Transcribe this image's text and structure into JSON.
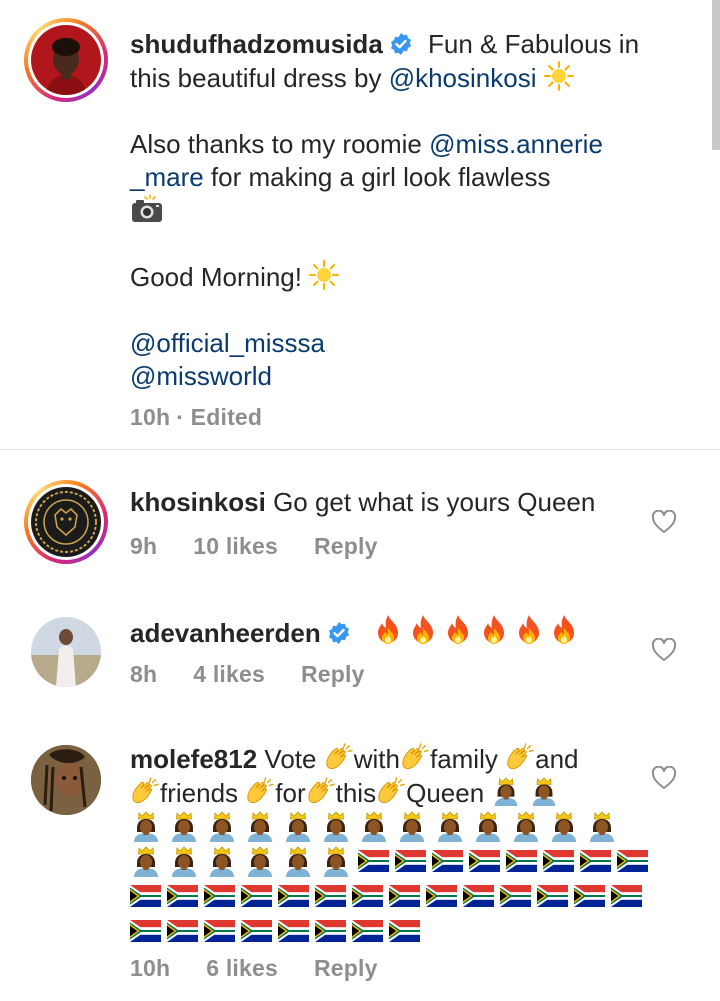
{
  "caption": {
    "username": "shudufhadzomusida",
    "line1_text": "Fun & Fabulous in",
    "line2_prefix": "this beautiful dress by ",
    "line2_mention": "@khosinkosi",
    "line3_prefix": "Also thanks to my roomie ",
    "line3_mention": "@miss.annerie",
    "line4_mention": "_mare",
    "line4_text": " for making a girl look flawless",
    "greeting": "Good Morning!",
    "mention_a": "@official_misssa",
    "mention_b": "@missworld",
    "time": "10h",
    "edited": "· Edited"
  },
  "comments": [
    {
      "username": "khosinkosi",
      "text": "Go get what is yours Queen",
      "time": "9h",
      "likes": "10 likes",
      "reply": "Reply"
    },
    {
      "username": "adevanheerden",
      "text": "",
      "time": "8h",
      "likes": "4 likes",
      "reply": "Reply"
    },
    {
      "username": "molefe812",
      "word_vote": "Vote",
      "word_with": "with",
      "word_family": "family",
      "word_and": "and",
      "word_friends": "friends",
      "word_for": "for",
      "word_this": "this",
      "word_queen": "Queen",
      "time": "10h",
      "likes": "6 likes",
      "reply": "Reply"
    }
  ],
  "icons": {
    "verified": "verified-badge-icon",
    "heart": "heart-outline-icon",
    "sun": "sun-icon",
    "camera": "camera-flash-icon",
    "fire": "fire-icon",
    "clap": "clapping-hands-icon",
    "queen": "woman-with-crown-icon",
    "flag": "south-africa-flag-icon"
  },
  "colors": {
    "mention": "#0b3b6e",
    "verified": "#3897f0",
    "meta": "#8e8e8e"
  }
}
